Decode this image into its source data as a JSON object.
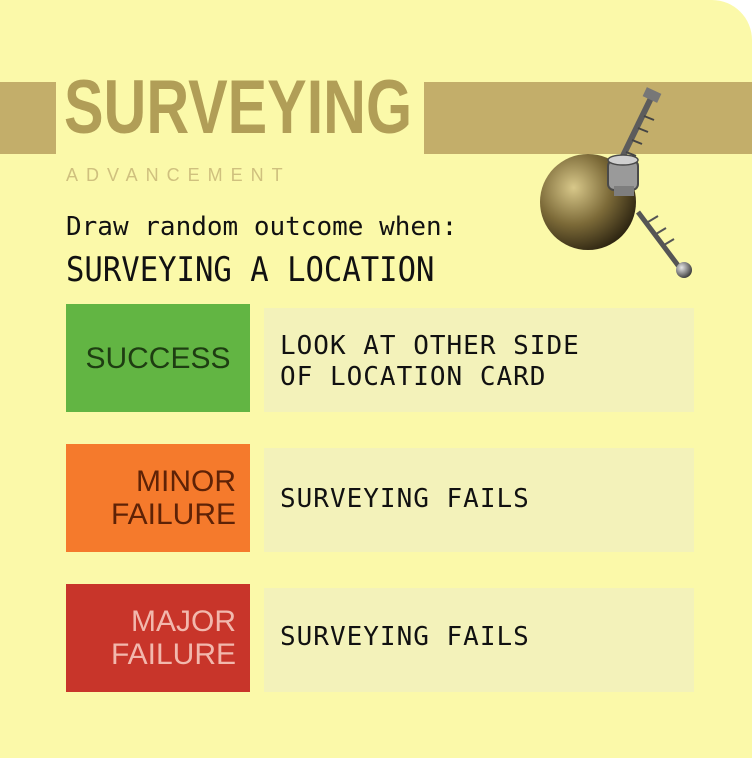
{
  "card": {
    "title": "SURVEYING",
    "subtitle": "ADVANCEMENT",
    "prompt": "Draw random outcome when:",
    "trigger": "SURVEYING A LOCATION"
  },
  "outcomes": [
    {
      "badge_lines": [
        "SUCCESS"
      ],
      "text_lines": [
        "LOOK AT OTHER SIDE",
        "OF LOCATION CARD"
      ],
      "color": "#62b543",
      "text_color": "#1e3d12"
    },
    {
      "badge_lines": [
        "MINOR",
        "FAILURE"
      ],
      "text_lines": [
        "SURVEYING FAILS"
      ],
      "color": "#f57a2c",
      "text_color": "#5e2206"
    },
    {
      "badge_lines": [
        "MAJOR",
        "FAILURE"
      ],
      "text_lines": [
        "SURVEYING FAILS"
      ],
      "color": "#c8352a",
      "text_color": "#f2b8ad"
    }
  ],
  "colors": {
    "card": "#fbf9a9",
    "band": "#c3ae6a",
    "title": "#b19e57"
  },
  "icons": {
    "probe": "space-probe-icon"
  }
}
